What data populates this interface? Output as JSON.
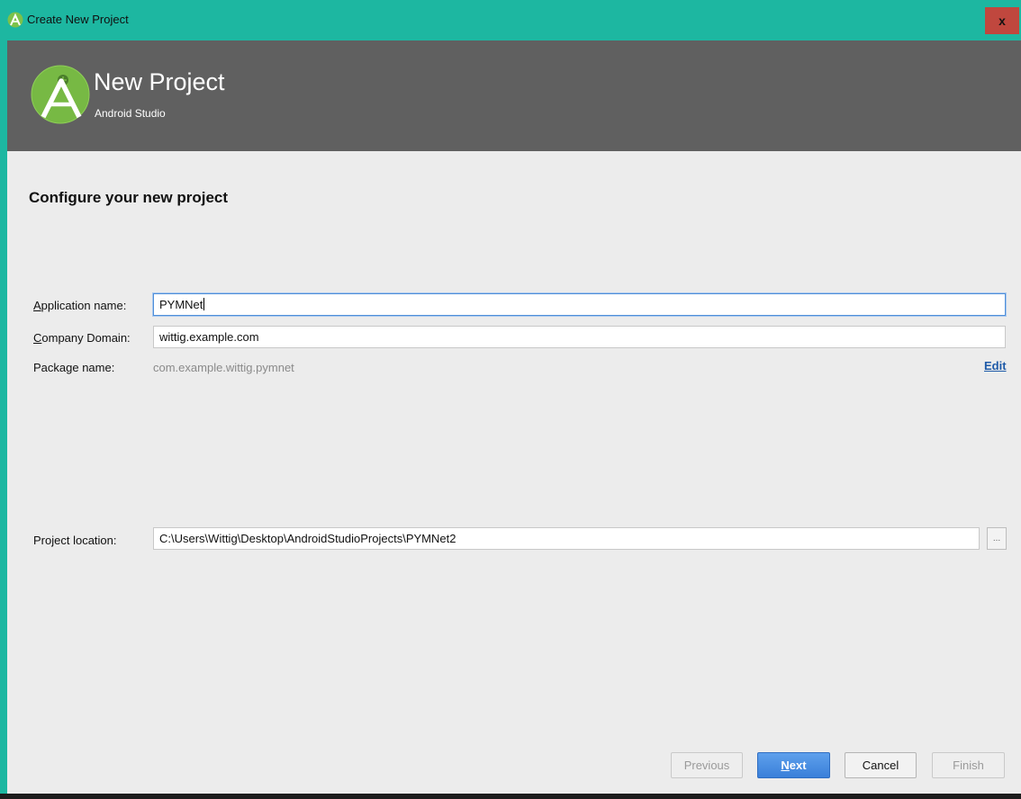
{
  "window": {
    "title": "Create New Project",
    "close_label": "x"
  },
  "header": {
    "title": "New Project",
    "subtitle": "Android Studio",
    "logo_icon": "android-studio-logo-icon"
  },
  "form": {
    "section_title": "Configure your new project",
    "app_name": {
      "label_mnemonic": "A",
      "label_rest": "pplication name:",
      "value": "PYMNet"
    },
    "company_domain": {
      "label_mnemonic": "C",
      "label_rest": "ompany Domain:",
      "value": "wittig.example.com"
    },
    "package_name": {
      "label": "Package name:",
      "value": "com.example.wittig.pymnet",
      "edit_label": "Edit"
    },
    "project_location": {
      "label": "Project location:",
      "value": "C:\\Users\\Wittig\\Desktop\\AndroidStudioProjects\\PYMNet2",
      "browse_label": "..."
    }
  },
  "buttons": {
    "previous": "Previous",
    "next_mnemonic": "N",
    "next_rest": "ext",
    "cancel": "Cancel",
    "finish": "Finish"
  },
  "colors": {
    "titlebar": "#1db7a1",
    "header": "#606060",
    "content": "#ececec",
    "close": "#c0473e",
    "primary_button": "#3a7fd9",
    "link": "#1e5aa8"
  }
}
